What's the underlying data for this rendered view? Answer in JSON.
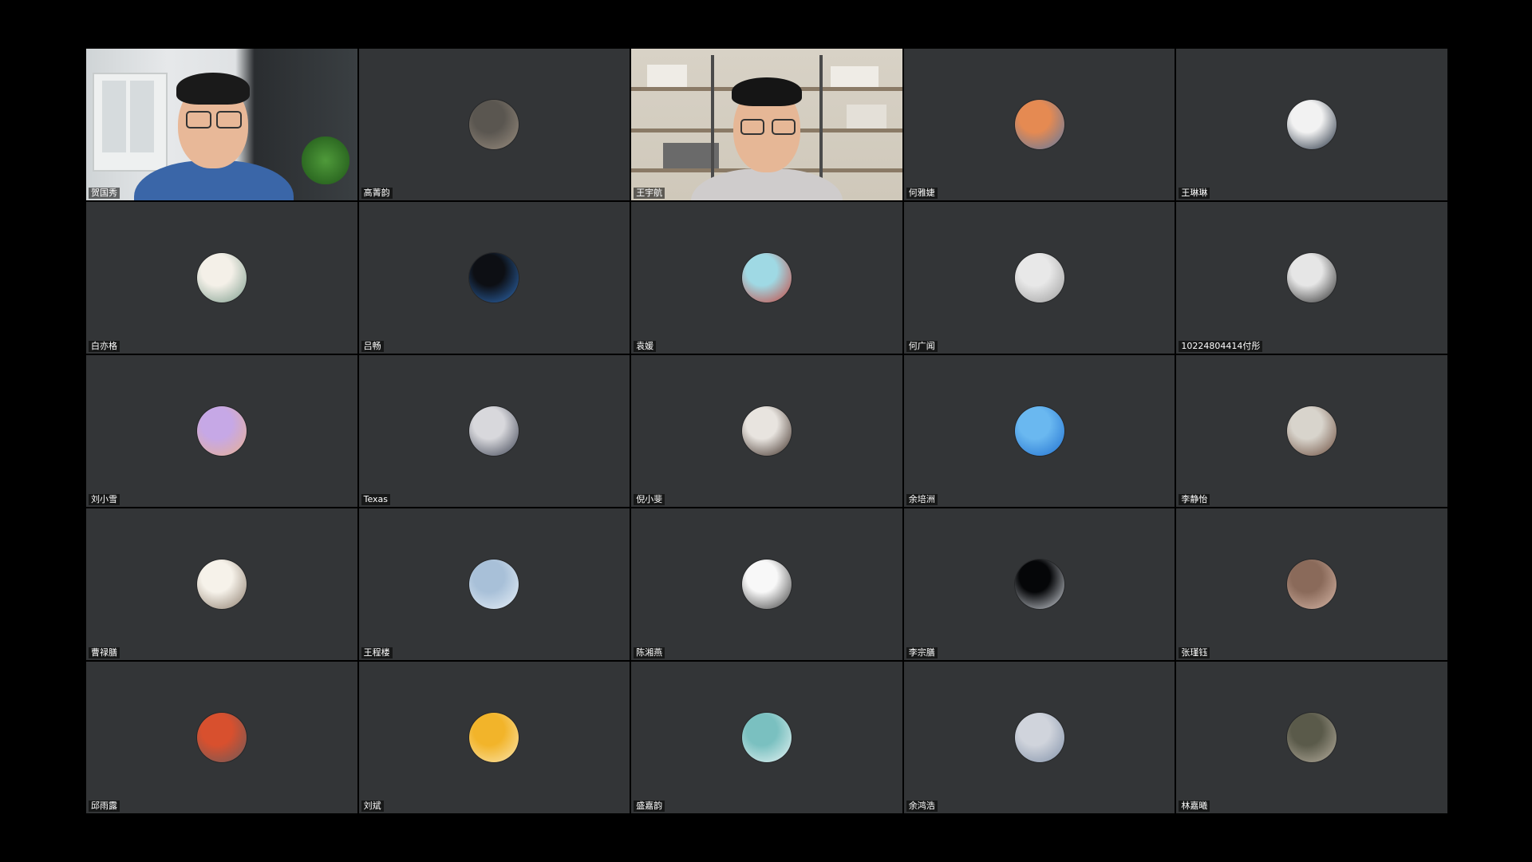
{
  "meeting": {
    "view": "gallery",
    "active_speaker_color": "#2ecc71",
    "participants": [
      {
        "name": "贺国秀",
        "video": true,
        "active_speaker": true
      },
      {
        "name": "高菁韵",
        "video": false,
        "avatar_colors": [
          "#5a5650",
          "#9a8e80"
        ]
      },
      {
        "name": "王宇航",
        "video": true,
        "active_speaker": false
      },
      {
        "name": "何雅婕",
        "video": false,
        "avatar_colors": [
          "#e58a52",
          "#5a78a4"
        ]
      },
      {
        "name": "王琳琳",
        "video": false,
        "avatar_colors": [
          "#f2f2f2",
          "#1e2a3a"
        ]
      },
      {
        "name": "白亦格",
        "video": false,
        "avatar_colors": [
          "#f4f0e8",
          "#7a9a8a"
        ]
      },
      {
        "name": "吕畅",
        "video": false,
        "avatar_colors": [
          "#0d0f14",
          "#2f6db8"
        ]
      },
      {
        "name": "袁媛",
        "video": false,
        "avatar_colors": [
          "#9fd9e4",
          "#c9423a"
        ]
      },
      {
        "name": "何广闻",
        "video": false,
        "avatar_colors": [
          "#e8e8e8",
          "#9a9a9a"
        ]
      },
      {
        "name": "10224804414付彤",
        "video": false,
        "avatar_colors": [
          "#e6e6e6",
          "#2a2a2a"
        ]
      },
      {
        "name": "刘小雪",
        "video": false,
        "avatar_colors": [
          "#c6a8e6",
          "#e8b090"
        ]
      },
      {
        "name": "Texas",
        "video": false,
        "avatar_colors": [
          "#d8d8dc",
          "#3a4050"
        ]
      },
      {
        "name": "倪小斐",
        "video": false,
        "avatar_colors": [
          "#e8e4df",
          "#3a2a22"
        ]
      },
      {
        "name": "余培洲",
        "video": false,
        "avatar_colors": [
          "#6ab8f0",
          "#1f6fd0"
        ]
      },
      {
        "name": "李静怡",
        "video": false,
        "avatar_colors": [
          "#d8d4cc",
          "#6a4a3a"
        ]
      },
      {
        "name": "曹禄膳",
        "video": false,
        "avatar_colors": [
          "#f6f2ea",
          "#8a7a6a"
        ]
      },
      {
        "name": "王程楼",
        "video": false,
        "avatar_colors": [
          "#a8c0d8",
          "#e8f0f8"
        ]
      },
      {
        "name": "陈湘燕",
        "video": false,
        "avatar_colors": [
          "#f8f8f8",
          "#3a3a3a"
        ]
      },
      {
        "name": "李宗膳",
        "video": false,
        "avatar_colors": [
          "#050608",
          "#d8dde4"
        ]
      },
      {
        "name": "张瑾钰",
        "video": false,
        "avatar_colors": [
          "#8a6a5a",
          "#d8b8a8"
        ]
      },
      {
        "name": "邱雨露",
        "video": false,
        "avatar_colors": [
          "#d8502e",
          "#6a5a5a"
        ]
      },
      {
        "name": "刘斌",
        "video": false,
        "avatar_colors": [
          "#f2b42a",
          "#fae6b0"
        ]
      },
      {
        "name": "盛嘉韵",
        "video": false,
        "avatar_colors": [
          "#7ac0c0",
          "#e8f4f4"
        ]
      },
      {
        "name": "余鸿浩",
        "video": false,
        "avatar_colors": [
          "#d0d4dc",
          "#8090a8"
        ]
      },
      {
        "name": "林嘉曦",
        "video": false,
        "avatar_colors": [
          "#5a5a4a",
          "#b8b0a0"
        ]
      }
    ]
  }
}
